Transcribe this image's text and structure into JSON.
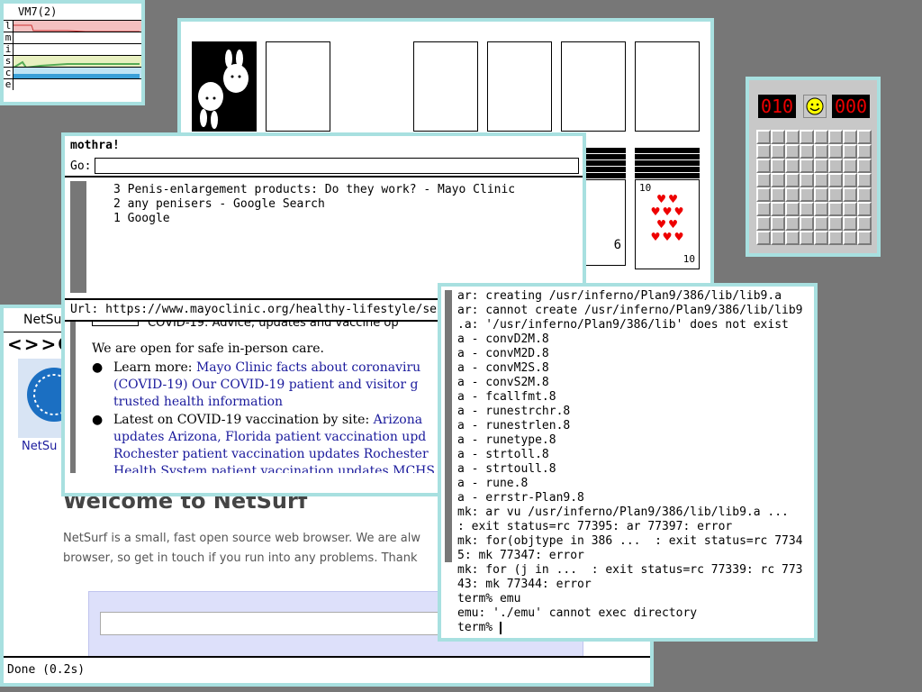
{
  "stats": {
    "title": "VM7(2)",
    "rows": [
      "l",
      "m",
      "i",
      "s",
      "c",
      "e"
    ]
  },
  "mothra": {
    "title": "mothra!",
    "go_label": "Go:",
    "go_value": "",
    "history": [
      "3 Penis-enlargement products: Do they work? - Mayo Clinic",
      "2 any penisers - Google Search",
      "1 Google"
    ],
    "url_label": "Url:",
    "url_value": "https://www.mayoclinic.org/healthy-lifestyle/se",
    "page": {
      "banner": "COVID-19: Advice, updates and vaccine op",
      "open_text": "We are open for safe in-person care.",
      "b1_prefix": "Learn more: ",
      "b1_link1": "Mayo Clinic facts about coronaviru",
      "b1_link2": "(COVID-19) Our COVID-19 patient and visitor g",
      "b1_link3": "trusted health information",
      "b2_prefix": "Latest on COVID-19 vaccination by site: ",
      "b2_link1": "Arizona",
      "b2_link2": "updates Arizona, Florida patient vaccination upd",
      "b2_link3": "Rochester patient vaccination updates Rochester",
      "b2_link4": "Health System patient vaccination updates MCHS"
    }
  },
  "netsurf": {
    "title": "NetSurf",
    "nav": "<>>C",
    "tab_label": "NetSu",
    "heading": "Welcome to NetSurf",
    "para": "NetSurf is a small, fast open source web browser. We are alw",
    "para2": "browser, so get in touch if you run into any problems. Thank",
    "status": "Done (0.2s)"
  },
  "terminal": {
    "lines": [
      "ar: creating /usr/inferno/Plan9/386/lib/lib9.a",
      "ar: cannot create /usr/inferno/Plan9/386/lib/lib9",
      ".a: '/usr/inferno/Plan9/386/lib' does not exist",
      "a - convD2M.8",
      "a - convM2D.8",
      "a - convM2S.8",
      "a - convS2M.8",
      "a - fcallfmt.8",
      "a - runestrchr.8",
      "a - runestrlen.8",
      "a - runetype.8",
      "a - strtoll.8",
      "a - strtoull.8",
      "a - rune.8",
      "a - errstr-Plan9.8",
      "mk: ar vu /usr/inferno/Plan9/386/lib/lib9.a ...",
      ": exit status=rc 77395: ar 77397: error",
      "mk: for(objtype in 386 ...  : exit status=rc 7734",
      "5: mk 77347: error",
      "mk: for (j in ...  : exit status=rc 77339: rc 773",
      "43: mk 77344: error",
      "term% emu",
      "emu: './emu' cannot exec directory",
      "term% "
    ]
  },
  "minesweeper": {
    "mines": "010",
    "time": "000"
  },
  "solitaire": {
    "card1_rank": "6",
    "card2_rank": "10"
  },
  "colors": {
    "desktop": "#777777",
    "border": "#a8e0e0",
    "link": "#1a1a9c"
  }
}
